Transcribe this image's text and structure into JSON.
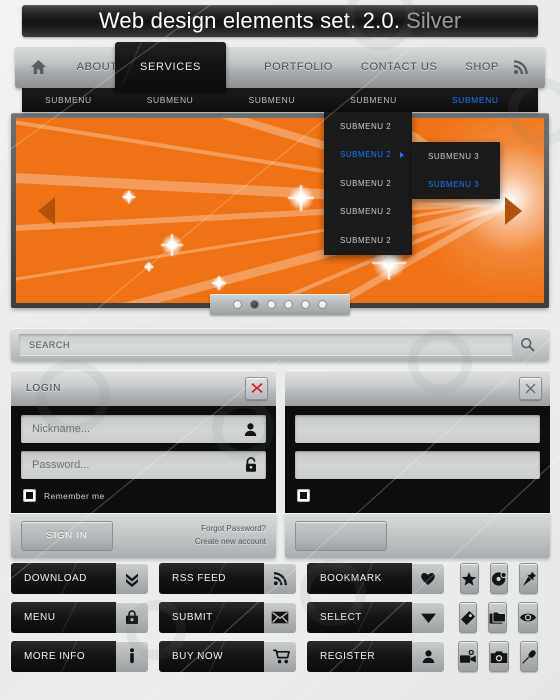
{
  "title": {
    "main": "Web design elements set. 2.0.",
    "accent": "Silver"
  },
  "nav": {
    "home_icon": "home-icon",
    "rss_icon": "rss-icon",
    "items": [
      {
        "label": "ABOUT US",
        "active": false
      },
      {
        "label": "SERVICES",
        "active": true
      },
      {
        "label": "PORTFOLIO",
        "active": false
      },
      {
        "label": "CONTACT US",
        "active": false
      },
      {
        "label": "SHOP",
        "active": false
      }
    ]
  },
  "submenu_bar": {
    "items": [
      {
        "label": "SUBMENU",
        "active": false
      },
      {
        "label": "SUBMENU",
        "active": false
      },
      {
        "label": "SUBMENU",
        "active": false
      },
      {
        "label": "SUBMENU",
        "active": false
      },
      {
        "label": "SUBMENU",
        "active": true
      }
    ]
  },
  "dropdown": {
    "items": [
      {
        "label": "SUBMENU 2",
        "active": false,
        "has_arrow": false
      },
      {
        "label": "SUBMENU 2",
        "active": true,
        "has_arrow": true
      },
      {
        "label": "SUBMENU 2",
        "active": false,
        "has_arrow": false
      },
      {
        "label": "SUBMENU 2",
        "active": false,
        "has_arrow": false
      },
      {
        "label": "SUBMENU 2",
        "active": false,
        "has_arrow": false
      }
    ]
  },
  "submenu_flyout": {
    "items": [
      {
        "label": "SUBMENU 3",
        "active": false
      },
      {
        "label": "SUBMENU 3",
        "active": true
      }
    ]
  },
  "banner": {
    "background_color": "#ef7215",
    "prev_arrow_icon": "arrow-left-icon",
    "next_arrow_icon": "arrow-right-icon",
    "pager": {
      "count": 6,
      "active_index": 1
    }
  },
  "search": {
    "value": "SEARCH",
    "placeholder": "SEARCH",
    "icon": "search-icon"
  },
  "login_panel": {
    "title": "LOGIN",
    "close_icon": "close-icon-red",
    "nickname": {
      "placeholder": "Nickname...",
      "icon": "user-icon"
    },
    "password": {
      "placeholder": "Password...",
      "icon": "lock-icon"
    },
    "remember": {
      "label": "Remember me",
      "checked": true
    },
    "signin_label": "SIGN IN",
    "links": [
      "Forgot Password?",
      "Create new account"
    ]
  },
  "blank_panel": {
    "title": "",
    "close_icon": "close-icon-grey",
    "field1": "",
    "field2": "",
    "remember_checked": true,
    "button_label": ""
  },
  "buttons": {
    "rows": [
      [
        {
          "label": "DOWNLOAD",
          "icon": "double-chevron-down-icon"
        },
        {
          "label": "RSS FEED",
          "icon": "rss-icon"
        },
        {
          "label": "BOOKMARK",
          "icon": "heart-icon"
        }
      ],
      [
        {
          "label": "MENU",
          "icon": "briefcase-icon"
        },
        {
          "label": "SUBMIT",
          "icon": "envelope-icon"
        },
        {
          "label": "SELECT",
          "icon": "triangle-down-icon"
        }
      ],
      [
        {
          "label": "MORE INFO",
          "icon": "info-icon"
        },
        {
          "label": "BUY NOW",
          "icon": "shopping-cart-icon"
        },
        {
          "label": "REGISTER",
          "icon": "user-icon"
        }
      ]
    ]
  },
  "icon_grid": {
    "rows": [
      [
        "star-icon",
        "disc-icon",
        "pushpin-icon"
      ],
      [
        "tag-icon",
        "folder-icon",
        "eye-icon"
      ],
      [
        "video-camera-icon",
        "photo-camera-icon",
        "microphone-icon"
      ]
    ]
  },
  "colors": {
    "accent_blue": "#1e78ff",
    "orange": "#ef7215",
    "dark": "#0d0d0d",
    "silver": "#b3b7b9"
  }
}
